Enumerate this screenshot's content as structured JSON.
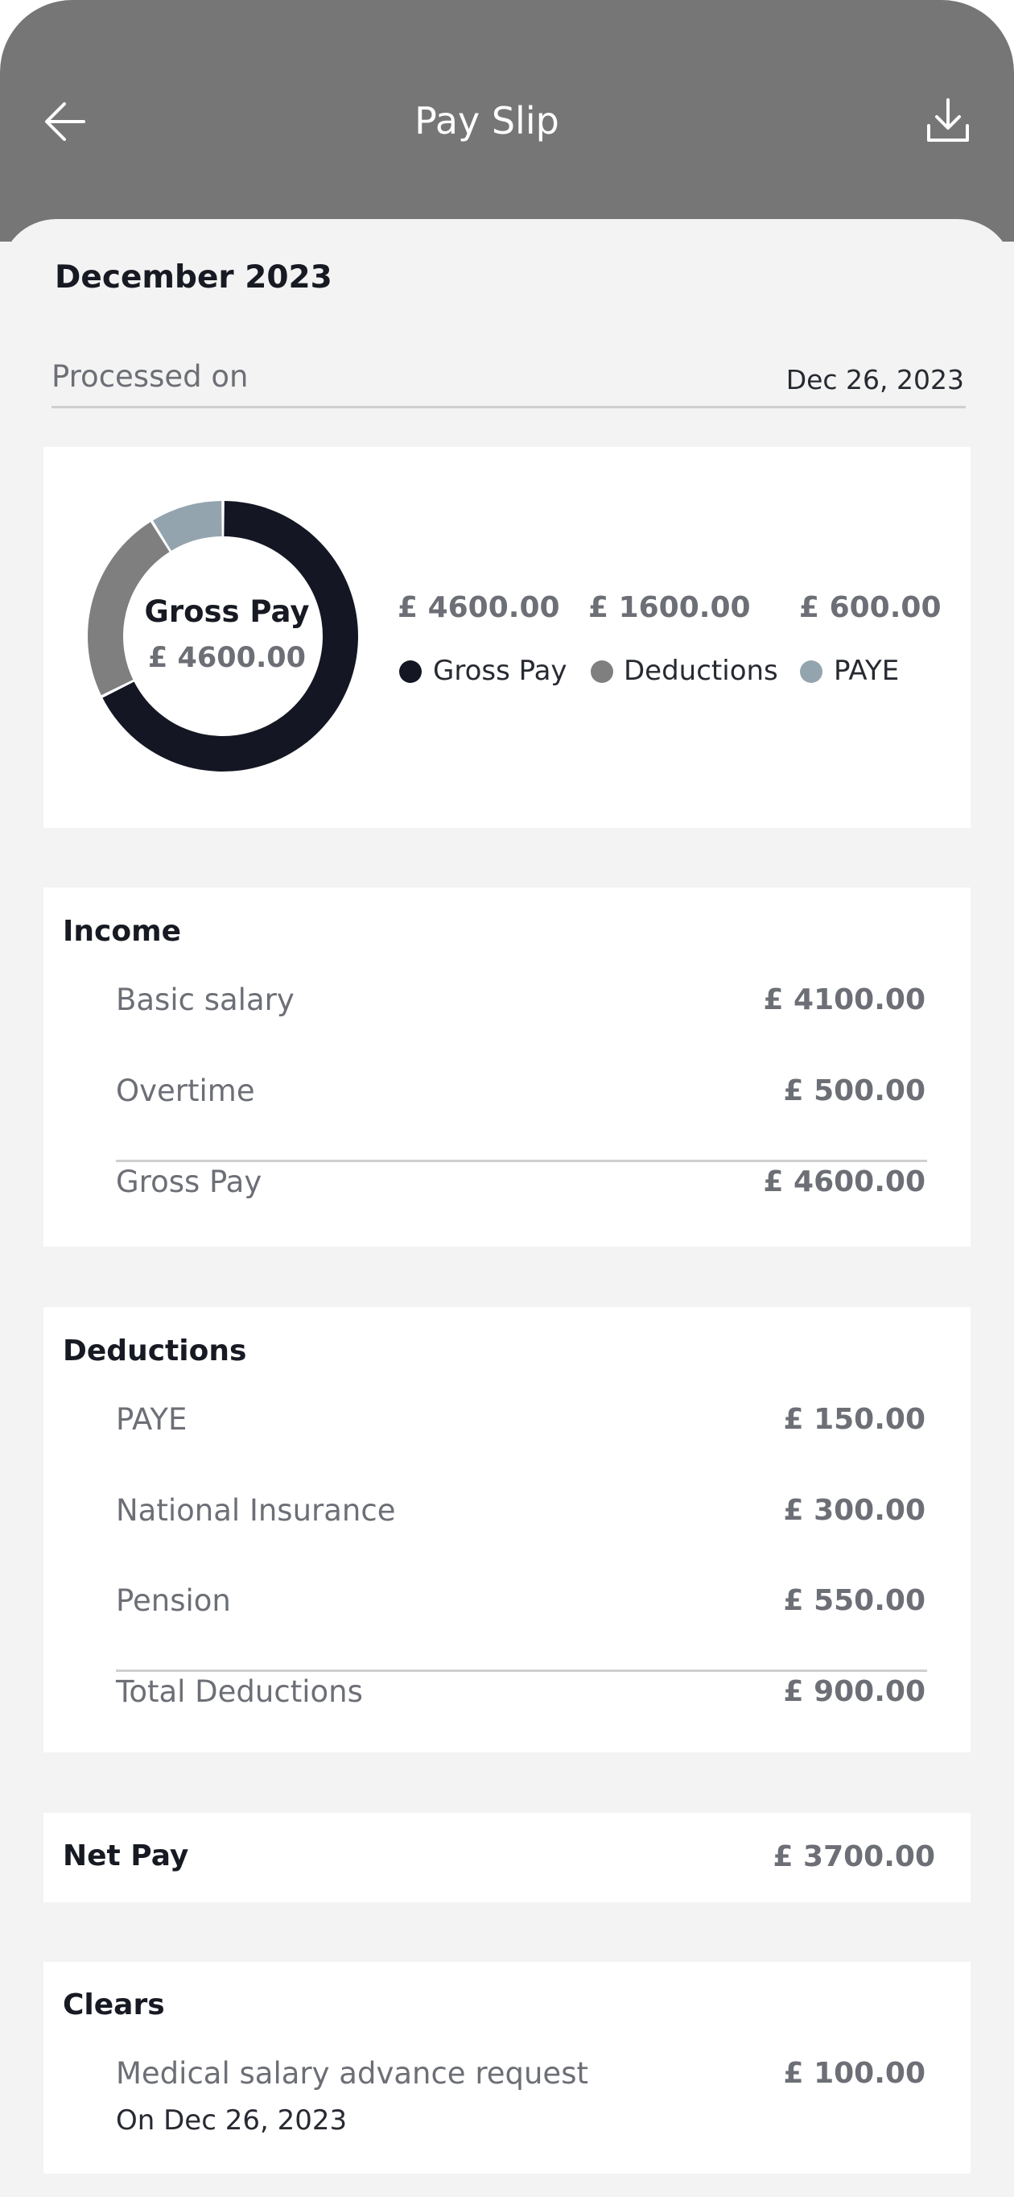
{
  "header": {
    "title": "Pay Slip",
    "back_icon": "arrow-left-icon",
    "download_icon": "download-icon"
  },
  "period": {
    "month": "December 2023",
    "processed_label": "Processed on",
    "processed_date": "Dec 26, 2023"
  },
  "summary_chart": {
    "center_title": "Gross Pay",
    "center_value": "£ 4600.00",
    "legend": [
      {
        "label": "Gross Pay",
        "value": "£ 4600.00",
        "color": "#141723"
      },
      {
        "label": "Deductions",
        "value": "£ 1600.00",
        "color": "#7f7f7f"
      },
      {
        "label": "PAYE",
        "value": "£ 600.00",
        "color": "#94a4ae"
      }
    ]
  },
  "chart_data": {
    "type": "pie",
    "categories": [
      "Gross Pay",
      "Deductions",
      "PAYE"
    ],
    "values": [
      4600,
      1600,
      600
    ],
    "colors": [
      "#141723",
      "#7f7f7f",
      "#94a4ae"
    ],
    "title": "",
    "legend_placement": "right"
  },
  "income": {
    "title": "Income",
    "items": [
      {
        "label": "Basic salary",
        "value": "£ 4100.00"
      },
      {
        "label": "Overtime",
        "value": "£ 500.00"
      }
    ],
    "total": {
      "label": "Gross Pay",
      "value": "£ 4600.00"
    }
  },
  "deductions": {
    "title": "Deductions",
    "items": [
      {
        "label": "PAYE",
        "value": "£ 150.00"
      },
      {
        "label": "National Insurance",
        "value": "£ 300.00"
      },
      {
        "label": "Pension",
        "value": "£ 550.00"
      }
    ],
    "total": {
      "label": "Total Deductions",
      "value": "£ 900.00"
    }
  },
  "net_pay": {
    "label": "Net Pay",
    "value": "£ 3700.00"
  },
  "clears": {
    "title": "Clears",
    "items": [
      {
        "label": "Medical salary advance request",
        "value": "£ 100.00",
        "date": "On Dec 26, 2023"
      }
    ]
  }
}
